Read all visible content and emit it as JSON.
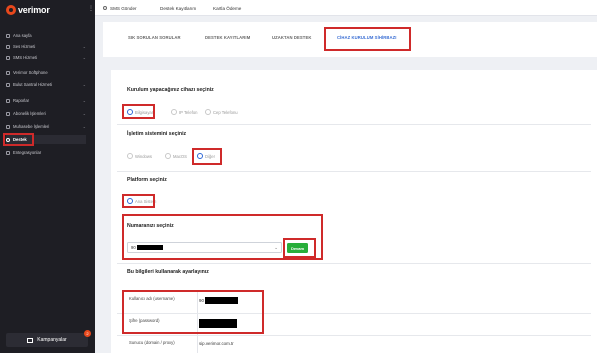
{
  "brand": {
    "name": "verimor",
    "accent": "#e8481c"
  },
  "sidebar": {
    "items": [
      {
        "label": "Ana sayfa",
        "chevron": false
      },
      {
        "label": "Ses Hizmeti",
        "chevron": true
      },
      {
        "label": "SMS Hizmeti",
        "chevron": true
      },
      {
        "label": "Verimor Softphone",
        "chevron": false
      },
      {
        "label": "Bulut Santral Hizmeti",
        "chevron": true
      },
      {
        "label": "Raporlar",
        "chevron": true
      },
      {
        "label": "Abonelik İşlemleri",
        "chevron": true
      },
      {
        "label": "Muhasebe İşlemleri",
        "chevron": true
      },
      {
        "label": "Destek",
        "chevron": false,
        "active": true
      },
      {
        "label": "Entegrasyonlar",
        "chevron": false
      }
    ],
    "campaign_label": "Kampanyalar",
    "campaign_badge": "2"
  },
  "topbar": {
    "items": [
      "SMS Gönder",
      "Destek Kayıtlarım",
      "Kartla Ödeme"
    ]
  },
  "tabs": [
    {
      "label": "SIK SORULAN SORULAR"
    },
    {
      "label": "DESTEK KAYITLARIM"
    },
    {
      "label": "UZAKTAN DESTEK"
    },
    {
      "label": "CİHAZ KURULUM SİHİRBAZI",
      "active": true
    }
  ],
  "form": {
    "device_label": "Kurulum yapacağınız cihazı seçiniz",
    "device_options": [
      {
        "label": "Bilgisayar",
        "checked": true
      },
      {
        "label": "IP Telefon",
        "checked": false
      },
      {
        "label": "Cep Telefonu",
        "checked": false
      }
    ],
    "os_label": "İşletim sistemini seçiniz",
    "os_options": [
      {
        "label": "Windows",
        "checked": false
      },
      {
        "label": "MacOS",
        "checked": false
      },
      {
        "label": "Diğer",
        "checked": true
      }
    ],
    "platform_label": "Platform seçiniz",
    "platform_options": [
      {
        "label": "Ana Sistem",
        "checked": true
      }
    ],
    "number_label": "Numaranızı seçiniz",
    "number_value_prefix": "90",
    "continue_label": "Devam",
    "settings_label": "Bu bilgileri kullanarak ayarlayınız",
    "fields": [
      {
        "label": "Kullanıcı adı (username)",
        "value_prefix": "90"
      },
      {
        "label": "Şifre (password)",
        "value_prefix": ""
      },
      {
        "label": "Sunucu (domain / proxy)",
        "value_prefix": "sip.verimor.com.tr"
      }
    ]
  },
  "colors": {
    "annotation": "#cf2a2a",
    "primary": "#2d66d6",
    "success": "#27ae3a",
    "sidebar_bg": "#1e1e24"
  }
}
